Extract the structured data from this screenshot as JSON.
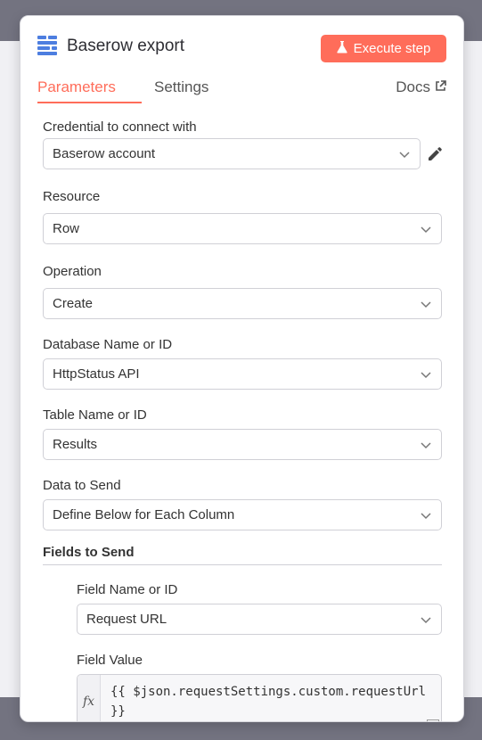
{
  "node": {
    "title": "Baserow export",
    "execute_label": "Execute step",
    "icon": "baserow-icon"
  },
  "tabs": [
    {
      "label": "Parameters",
      "active": true
    },
    {
      "label": "Settings",
      "active": false
    }
  ],
  "docs_label": "Docs",
  "fields": {
    "credential": {
      "label": "Credential to connect with",
      "value": "Baserow account"
    },
    "resource": {
      "label": "Resource",
      "value": "Row"
    },
    "operation": {
      "label": "Operation",
      "value": "Create"
    },
    "database": {
      "label": "Database Name or ID",
      "value": "HttpStatus API"
    },
    "table": {
      "label": "Table Name or ID",
      "value": "Results"
    },
    "data_to_send": {
      "label": "Data to Send",
      "value": "Define Below for Each Column"
    }
  },
  "fields_to_send": {
    "label": "Fields to Send",
    "field_name": {
      "label": "Field Name or ID",
      "value": "Request URL"
    },
    "field_value": {
      "label": "Field Value",
      "fx": "fx",
      "expression": "{{ $json.requestSettings.custom.requestUrl }}"
    }
  },
  "colors": {
    "accent": "#ff6d5a",
    "baserow": "#4d7ee0"
  }
}
